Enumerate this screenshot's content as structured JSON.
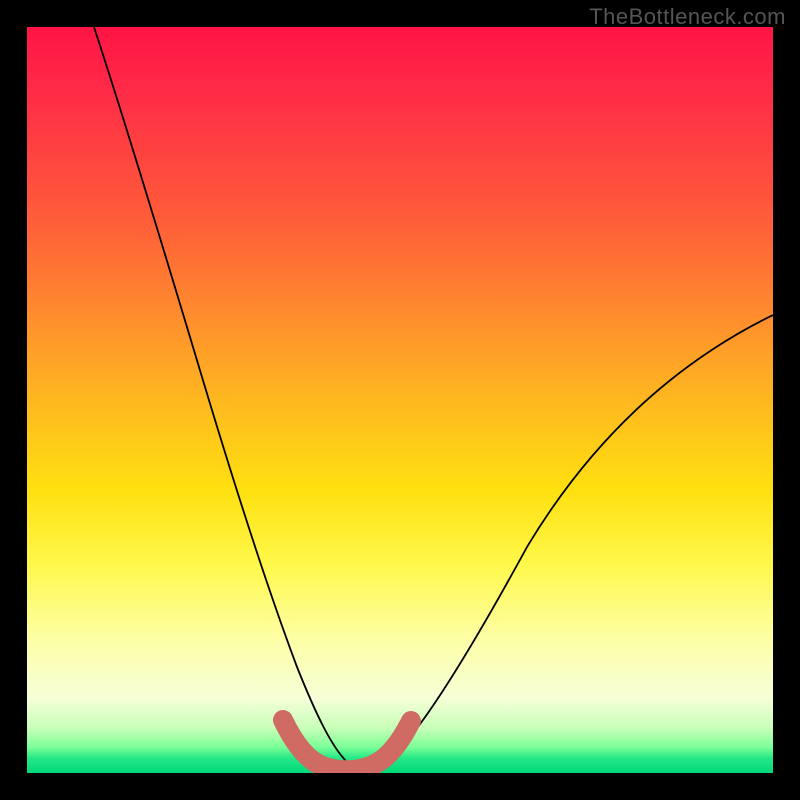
{
  "watermark": "TheBottleneck.com",
  "chart_data": {
    "type": "line",
    "title": "",
    "xlabel": "",
    "ylabel": "",
    "xlim": [
      0,
      100
    ],
    "ylim": [
      0,
      100
    ],
    "grid": false,
    "legend": false,
    "series": [
      {
        "name": "bottleneck-curve",
        "x": [
          9,
          12,
          16,
          20,
          24,
          28,
          31,
          34,
          36,
          38,
          40,
          42,
          44,
          48,
          52,
          56,
          60,
          66,
          74,
          82,
          90,
          100
        ],
        "y": [
          100,
          88,
          73,
          59,
          46,
          34,
          24,
          15,
          8,
          3,
          1,
          0.5,
          1,
          2,
          5,
          10,
          16,
          24,
          34,
          44,
          52,
          61
        ],
        "stroke": "#000000",
        "stroke_width": 1.5
      },
      {
        "name": "optimal-marker",
        "x": [
          34,
          36,
          38,
          40,
          42,
          44,
          46,
          48,
          50
        ],
        "y": [
          6,
          3,
          1.5,
          1,
          1,
          1.5,
          3,
          5,
          8
        ],
        "stroke": "#cf6b63",
        "stroke_width": 12,
        "linecap": "round"
      }
    ],
    "background": {
      "type": "vertical-gradient",
      "stops": [
        {
          "pos": 0,
          "color": "#ff1445"
        },
        {
          "pos": 50,
          "color": "#ffb820"
        },
        {
          "pos": 82,
          "color": "#fdffa5"
        },
        {
          "pos": 100,
          "color": "#00d877"
        }
      ]
    }
  }
}
